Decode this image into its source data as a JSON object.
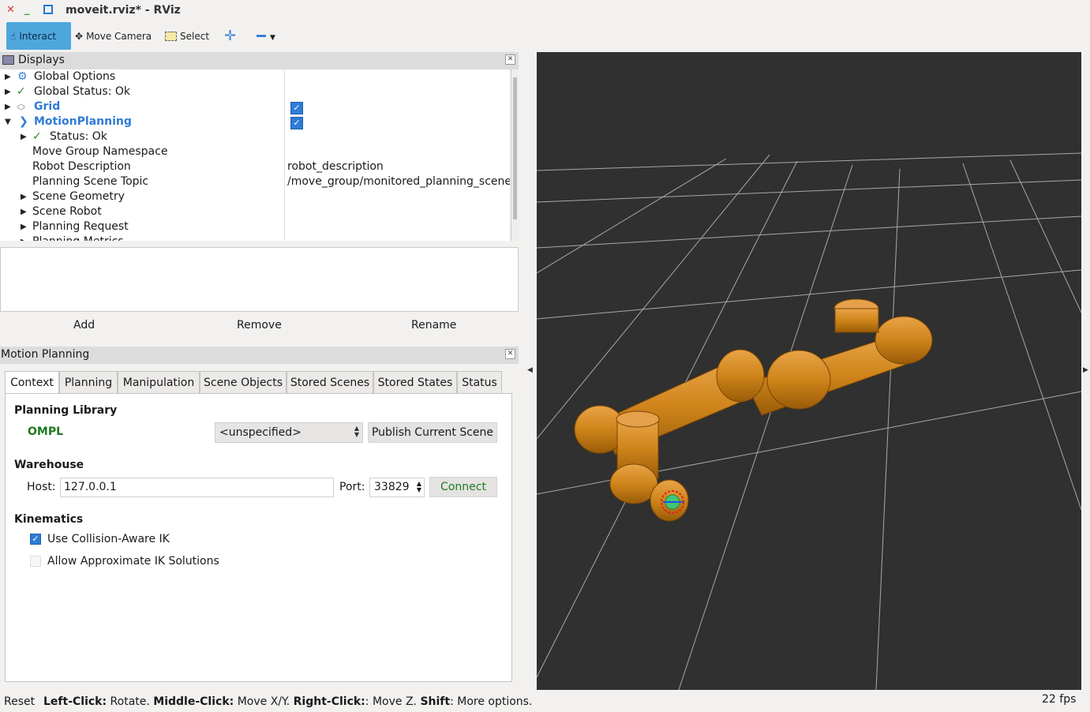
{
  "window": {
    "title": "moveit.rviz* - RViz"
  },
  "toolbar": {
    "interact": "Interact",
    "move_camera": "Move Camera",
    "select": "Select",
    "add_icon": "plus-icon",
    "remove_icon": "minus-icon"
  },
  "displays": {
    "title": "Displays",
    "items": {
      "global_options": "Global Options",
      "global_status": "Global Status: Ok",
      "grid": "Grid",
      "motion_planning": "MotionPlanning",
      "status": "Status: Ok",
      "move_group_namespace": "Move Group Namespace",
      "robot_description": "Robot Description",
      "robot_description_value": "robot_description",
      "planning_scene_topic": "Planning Scene Topic",
      "planning_scene_topic_value": "/move_group/monitored_planning_scene",
      "scene_geometry": "Scene Geometry",
      "scene_robot": "Scene Robot",
      "planning_request": "Planning Request",
      "planning_metrics_partial": "Planning Metrics"
    },
    "buttons": {
      "add": "Add",
      "remove": "Remove",
      "rename": "Rename"
    }
  },
  "motion_planning": {
    "title": "Motion Planning",
    "tabs": [
      "Context",
      "Planning",
      "Manipulation",
      "Scene Objects",
      "Stored Scenes",
      "Stored States",
      "Status"
    ],
    "context": {
      "planning_library_label": "Planning Library",
      "library": "OMPL",
      "planner": "<unspecified>",
      "publish_button": "Publish Current Scene",
      "warehouse_label": "Warehouse",
      "host_label": "Host:",
      "host_value": "127.0.0.1",
      "port_label": "Port:",
      "port_value": "33829",
      "connect_button": "Connect",
      "kinematics_label": "Kinematics",
      "collision_aware_ik": "Use Collision-Aware IK",
      "approximate_ik": "Allow Approximate IK Solutions"
    }
  },
  "statusbar": {
    "reset": "Reset",
    "left_click": "Left-Click:",
    "left_click_desc": " Rotate. ",
    "middle_click": "Middle-Click:",
    "middle_click_desc": " Move X/Y. ",
    "right_click": "Right-Click:",
    "right_click_desc": ": Move Z. ",
    "shift": "Shift",
    "shift_desc": ": More options.",
    "fps": "22 fps"
  },
  "colors": {
    "viewport_bg": "#303030",
    "grid_line": "#a8a8a8",
    "robot_orange": "#d08a1e",
    "accent_blue": "#2f7bd6",
    "ok_green": "#1e7a1e"
  }
}
